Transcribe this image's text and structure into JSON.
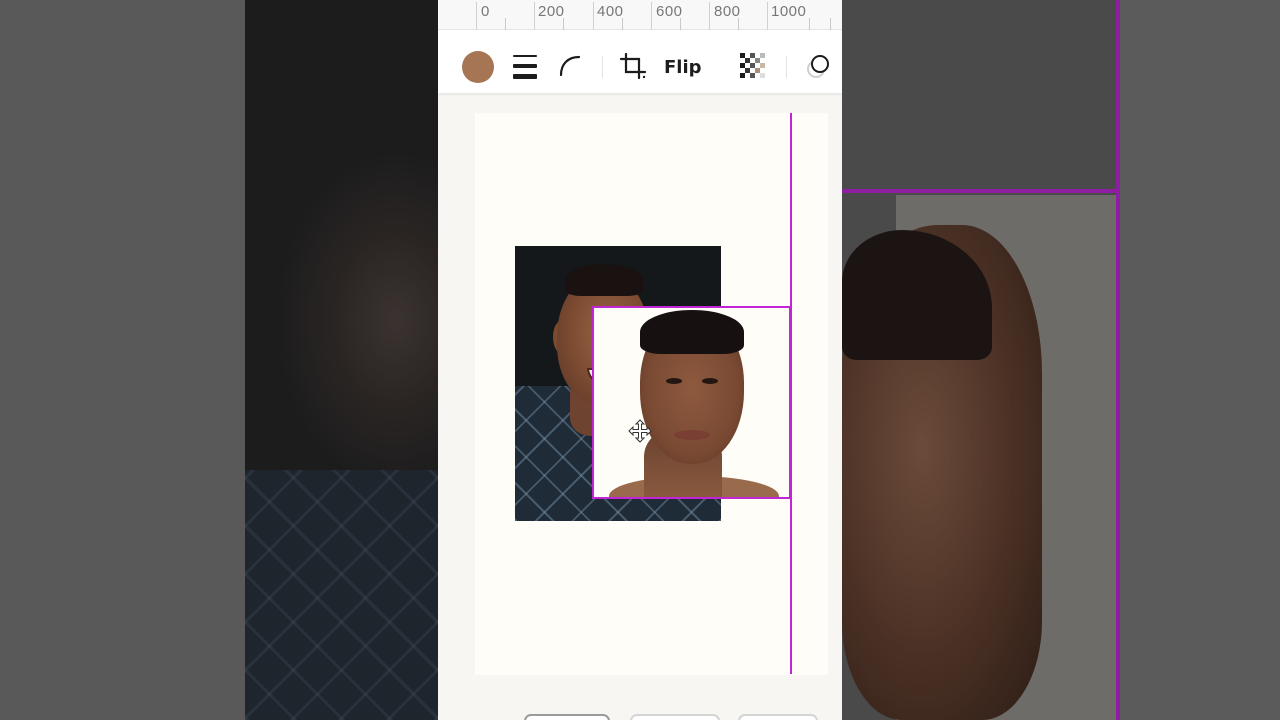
{
  "ruler": {
    "labels": [
      "0",
      "200",
      "400",
      "600",
      "800",
      "1000"
    ]
  },
  "toolbar": {
    "color_swatch": {
      "icon": "color-swatch",
      "color": "#a57554"
    },
    "border_weight": {
      "icon": "border-weight-icon"
    },
    "corner_rounding": {
      "icon": "corner-curve-icon"
    },
    "crop": {
      "icon": "crop-icon"
    },
    "flip_label": "Flip",
    "transparency": {
      "icon": "transparency-checker-icon"
    },
    "effects": {
      "icon": "shadow-effect-icon"
    }
  },
  "canvas": {
    "accent_color": "#c026d3",
    "page_color": "#fefdf8",
    "move_cursor_icon": "move-arrows-icon"
  }
}
